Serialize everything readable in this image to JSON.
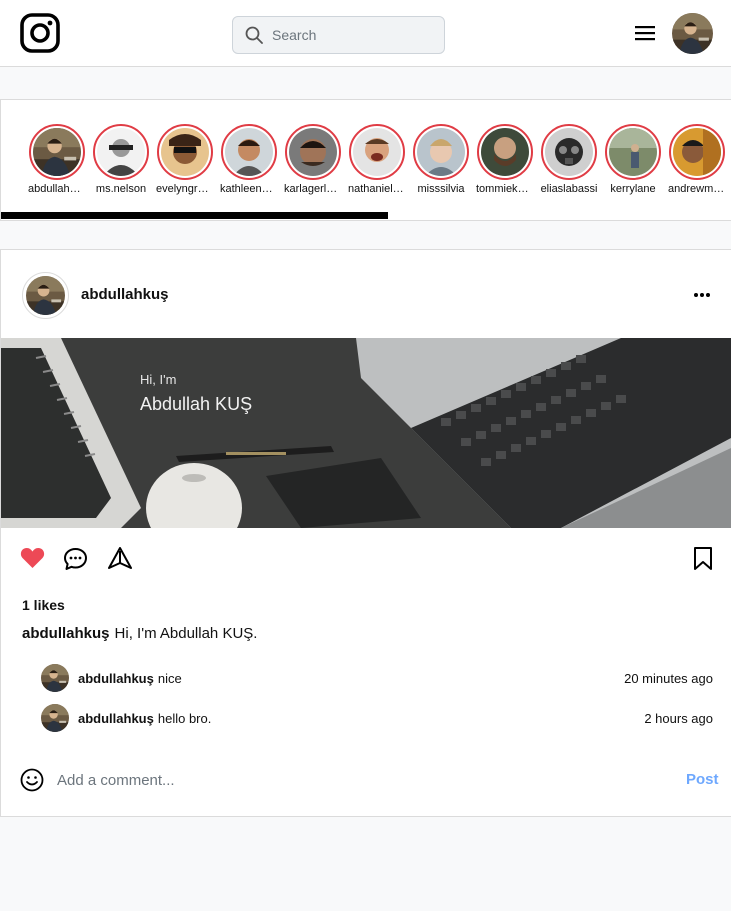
{
  "header": {
    "search_placeholder": "Search",
    "icons": {
      "logo": "instagram-logo",
      "search": "search-icon",
      "menu": "hamburger-icon"
    }
  },
  "stories": [
    {
      "name": "abdullahkus"
    },
    {
      "name": "ms.nelson"
    },
    {
      "name": "evelyngreen"
    },
    {
      "name": "kathleenmason"
    },
    {
      "name": "karlagerlach"
    },
    {
      "name": "nathanielbrown"
    },
    {
      "name": "misssilvia"
    },
    {
      "name": "tommiekelly"
    },
    {
      "name": "eliaslabassi"
    },
    {
      "name": "kerrylane"
    },
    {
      "name": "andrewmurphy"
    }
  ],
  "post": {
    "username": "abdullahkuş",
    "image_text": {
      "greeting": "Hi, I'm",
      "name": "Abdullah KUŞ"
    },
    "liked": true,
    "likes_text": "1 likes",
    "caption": {
      "username": "abdullahkuş",
      "text": "Hi, I'm Abdullah KUŞ."
    },
    "comments": [
      {
        "username": "abdullahkuş",
        "text": "nice",
        "time": "20 minutes ago"
      },
      {
        "username": "abdullahkuş",
        "text": "hello bro.",
        "time": "2 hours ago"
      }
    ],
    "comment_placeholder": "Add a comment...",
    "post_button": "Post"
  },
  "colors": {
    "story_ring": "#e03c45",
    "like": "#ed4956",
    "post_button": "#6ea8fe"
  }
}
